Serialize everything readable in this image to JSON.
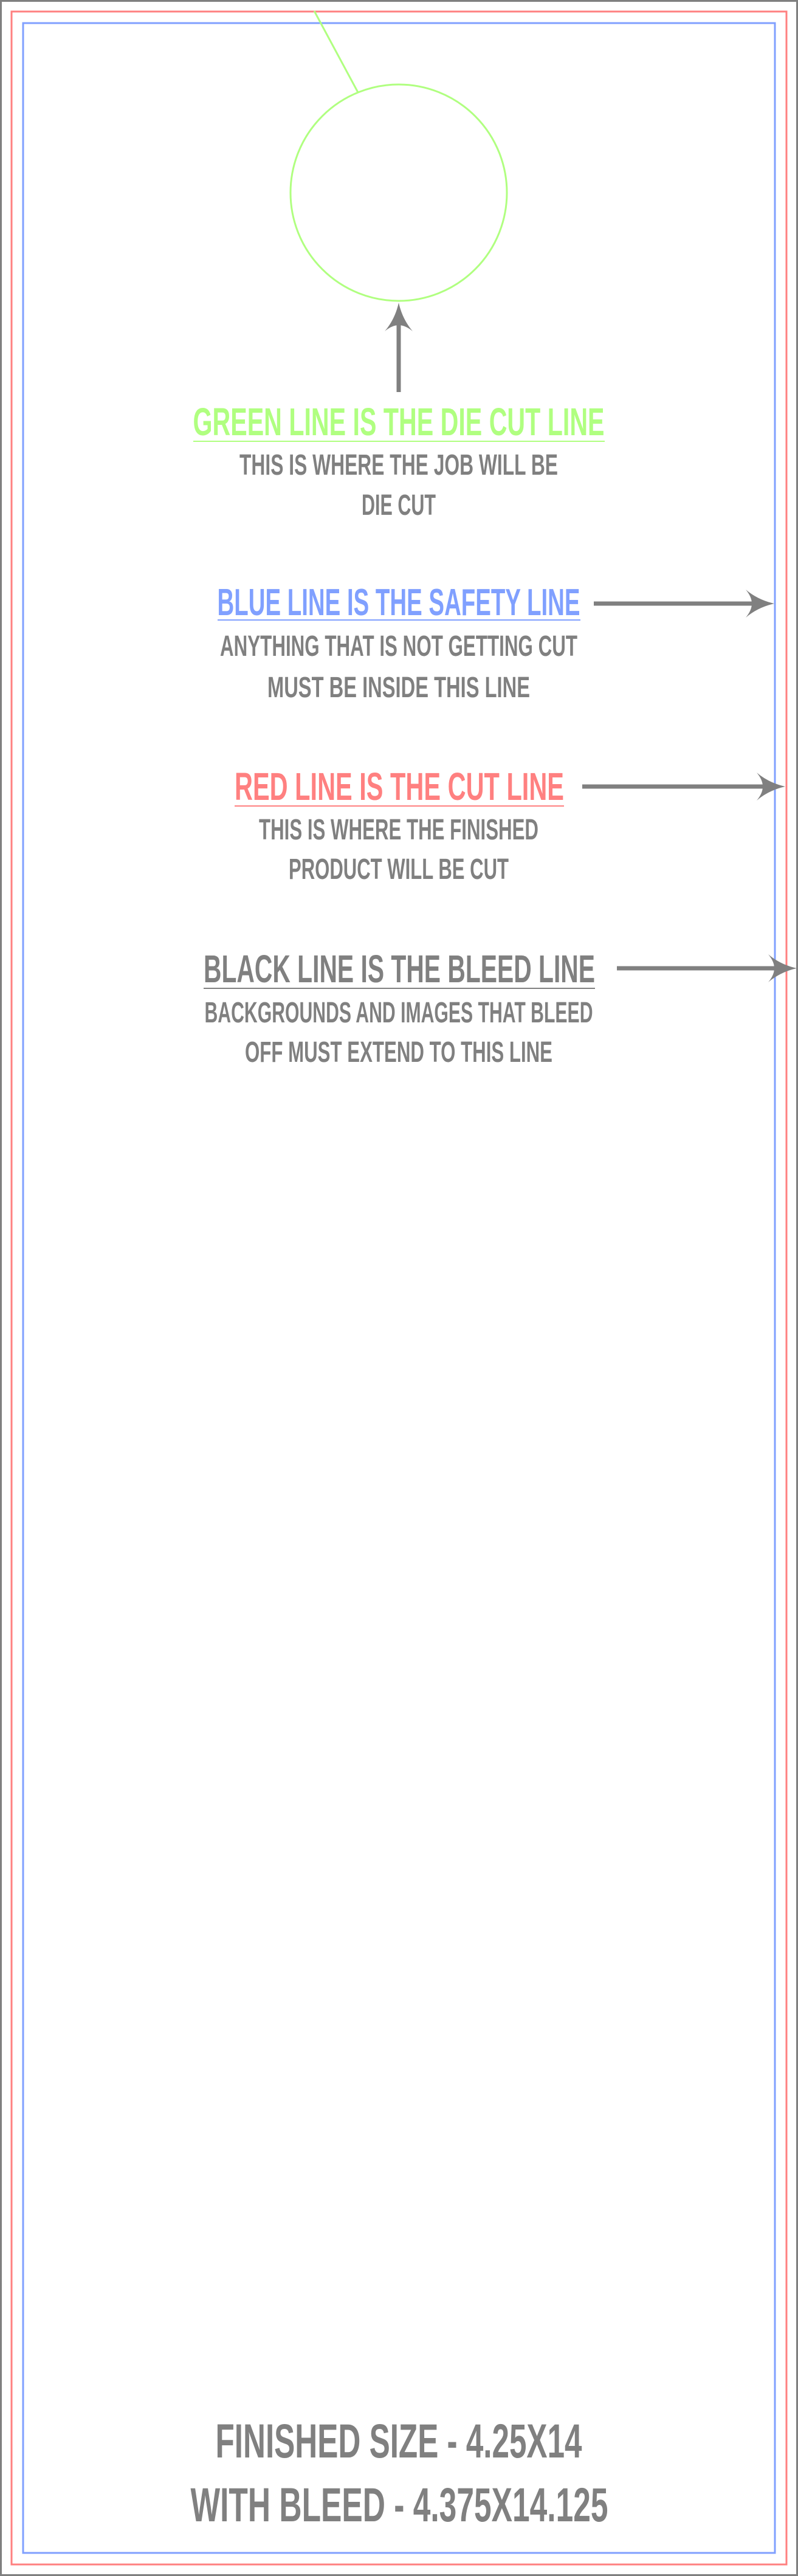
{
  "colors": {
    "bleed": "#808080",
    "cut": "#ff8080",
    "safety": "#80a0ff",
    "die_cut": "#b0ff80",
    "text": "#808080"
  },
  "sections": {
    "green": {
      "title": "GREEN LINE IS THE DIE CUT LINE",
      "line1": "THIS IS WHERE THE JOB WILL BE",
      "line2": "DIE CUT"
    },
    "blue": {
      "title": "BLUE LINE IS THE SAFETY LINE",
      "line1": "ANYTHING THAT IS NOT GETTING CUT",
      "line2": "MUST BE INSIDE THIS LINE"
    },
    "red": {
      "title": "RED LINE IS THE CUT LINE",
      "line1": "THIS IS WHERE THE FINISHED",
      "line2": "PRODUCT WILL BE CUT"
    },
    "black": {
      "title": "BLACK LINE IS THE BLEED LINE",
      "line1": "BACKGROUNDS AND IMAGES THAT BLEED",
      "line2": "OFF MUST EXTEND TO THIS LINE"
    }
  },
  "footer": {
    "finished_size": "FINISHED SIZE - 4.25X14",
    "with_bleed": "WITH BLEED - 4.375X14.125"
  }
}
